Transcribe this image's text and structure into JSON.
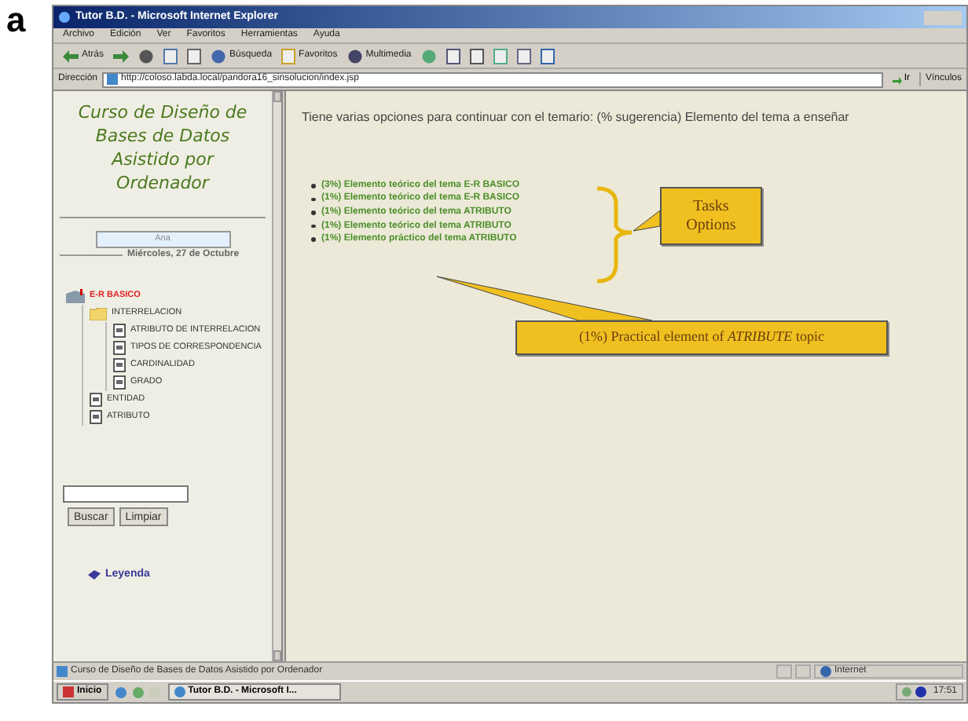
{
  "figure_label": "a",
  "window": {
    "title": "Tutor B.D. - Microsoft Internet Explorer"
  },
  "menu": [
    "Archivo",
    "Edición",
    "Ver",
    "Favoritos",
    "Herramientas",
    "Ayuda"
  ],
  "toolbar": [
    {
      "kind": "back",
      "label": "Atrás"
    },
    {
      "kind": "forward"
    },
    {
      "kind": "stop"
    },
    {
      "kind": "refresh"
    },
    {
      "kind": "home"
    },
    {
      "kind": "search",
      "label": "Búsqueda"
    },
    {
      "kind": "favorites",
      "label": "Favoritos"
    },
    {
      "kind": "media",
      "label": "Multimedia"
    },
    {
      "kind": "history"
    },
    {
      "kind": "mail"
    },
    {
      "kind": "print"
    },
    {
      "kind": "edit"
    },
    {
      "kind": "discuss"
    },
    {
      "kind": "messenger"
    }
  ],
  "address_bar": {
    "label": "Dirección",
    "url": "http://coloso.labda.local/pandora16_sinsolucion/index.jsp",
    "go": "Ir",
    "links": "Vínculos"
  },
  "sidebar": {
    "title": "Curso de Diseño de Bases de Datos Asistido por Ordenador",
    "user": "Ana",
    "date": "Miércoles, 27 de Octubre",
    "tree": [
      {
        "label": "E-R BASICO",
        "kind": "root",
        "selected": true,
        "children": [
          {
            "label": "INTERRELACION",
            "kind": "folder",
            "selected": false,
            "children": [
              {
                "label": "ATRIBUTO DE INTERRELACION",
                "kind": "page",
                "selected": false
              },
              {
                "label": "TIPOS DE CORRESPONDENCIA",
                "kind": "page",
                "selected": false
              },
              {
                "label": "CARDINALIDAD",
                "kind": "page",
                "selected": false
              },
              {
                "label": "GRADO",
                "kind": "page",
                "selected": false
              }
            ]
          },
          {
            "label": "ENTIDAD",
            "kind": "page",
            "selected": false
          },
          {
            "label": "ATRIBUTO",
            "kind": "page",
            "selected": false
          }
        ]
      }
    ],
    "search_buttons": [
      "Buscar",
      "Limpiar"
    ],
    "legend": "Leyenda"
  },
  "content": {
    "intro": "Tiene varias opciones para continuar con el temario: (% sugerencia) Elemento del tema a enseñar",
    "options": [
      "(3%) Elemento teórico del tema E-R BASICO",
      "(1%) Elemento teórico del tema E-R BASICO",
      "(1%) Elemento teórico del tema ATRIBUTO",
      "(1%) Elemento teórico del tema ATRIBUTO",
      "(1%) Elemento práctico del tema ATRIBUTO"
    ],
    "callouts": [
      {
        "kind": "group",
        "text": "Tasks Options"
      },
      {
        "kind": "item",
        "text": "(1%) Practical element of *ATRIBUTE* topic"
      }
    ]
  },
  "status_bar": {
    "text": "Curso de Diseño de Bases de Datos Asistido por Ordenador",
    "zone": "Internet"
  },
  "taskbar": {
    "start": "Inicio",
    "task": "Tutor B.D. - Microsoft I...",
    "clock": "17:51"
  }
}
